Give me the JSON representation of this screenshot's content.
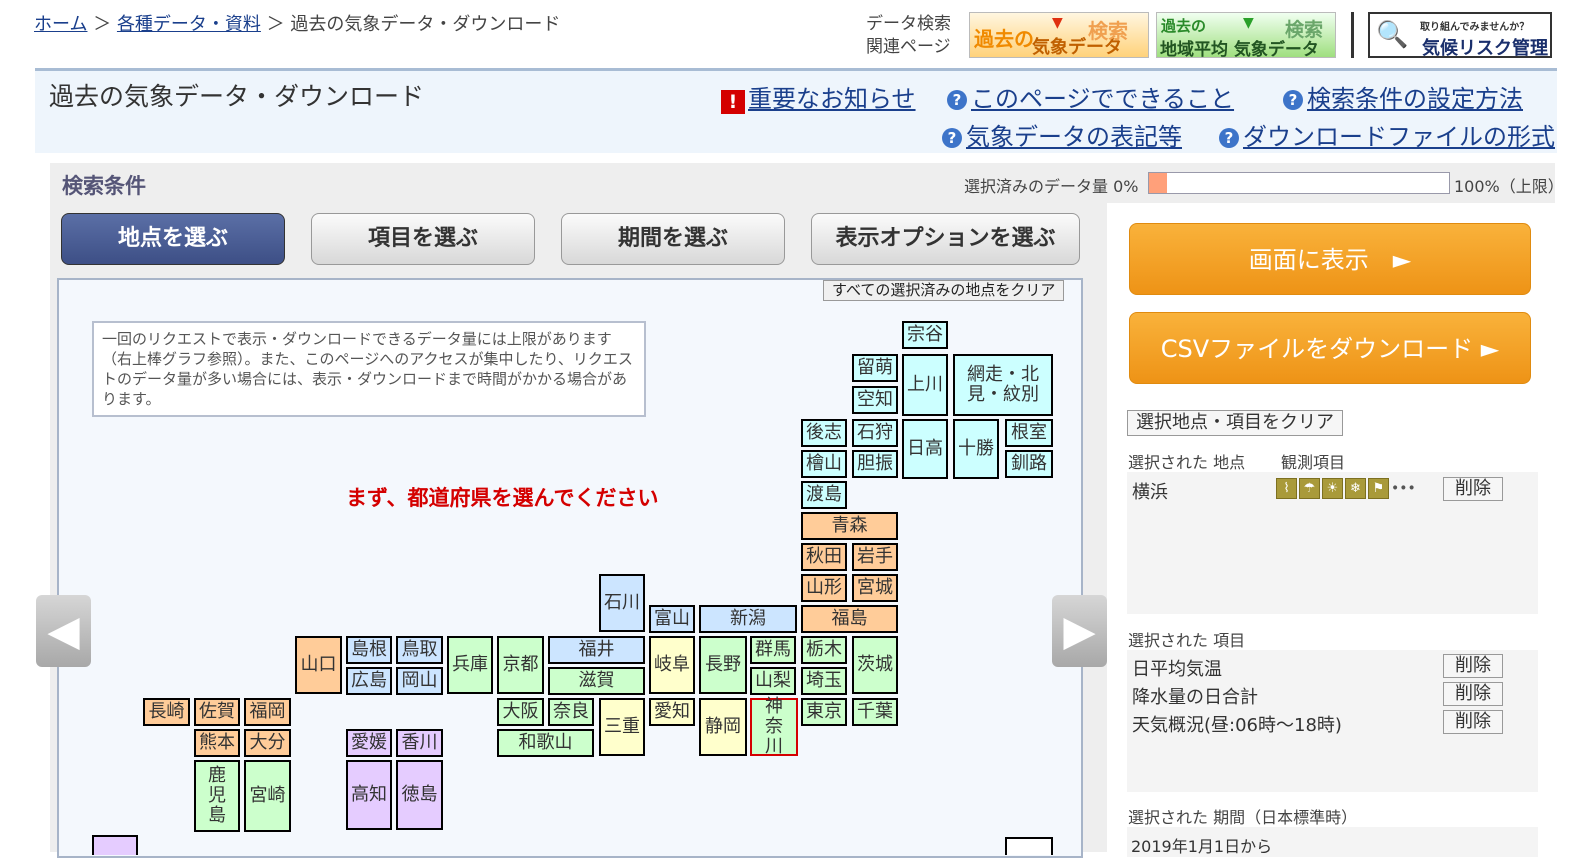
{
  "breadcrumb": {
    "home": "ホーム",
    "sep1": "＞",
    "data": "各種データ・資料",
    "sep2": "＞",
    "current": "過去の気象データ・ダウンロード"
  },
  "related": {
    "line1": "データ検索",
    "line2": "関連ページ"
  },
  "banners": {
    "past": {
      "text1": "過去の",
      "text2": "気象データ",
      "badge": "検索"
    },
    "area": {
      "text1": "過去の",
      "text2": "地域平均 気象データ",
      "badge": "検索"
    },
    "climate": {
      "text1": "取り組んでみませんか？",
      "text2": "気候リスク管理"
    }
  },
  "header": {
    "title": "過去の気象データ・ダウンロード",
    "links": {
      "notice": "重要なお知らせ",
      "can_do": "このページでできること",
      "howto": "検索条件の設定方法",
      "notation": "気象データの表記等",
      "format": "ダウンロードファイルの形式"
    }
  },
  "search": {
    "label": "検索条件",
    "amount_label": "選択済みのデータ量 0%",
    "amount_percent": 0,
    "amount_max": "100%（上限）"
  },
  "tabs": {
    "station": "地点を選ぶ",
    "item": "項目を選ぶ",
    "period": "期間を選ぶ",
    "options": "表示オプションを選ぶ"
  },
  "map": {
    "clear_all": "すべての選択済みの地点をクリア",
    "notice": "一回のリクエストで表示・ダウンロードできるデータ量には上限があります（右上棒グラフ参照）。また、このページへのアクセスが集中したり、リクエストのデータ量が多い場合には、表示・ダウンロードまで時間がかかる場合があります。",
    "prompt": "まず、都道府県を選んでください",
    "prefs": {
      "soya": "宗谷",
      "rumoi": "留萌",
      "kamikawa": "上川",
      "abashiri": "網走・北見・紋別",
      "sorachi": "空知",
      "shiribeshi": "後志",
      "ishikari": "石狩",
      "hidaka": "日高",
      "tokachi": "十勝",
      "nemuro": "根室",
      "hiyama": "檜山",
      "iburi": "胆振",
      "kushiro": "釧路",
      "oshima": "渡島",
      "aomori": "青森",
      "akita": "秋田",
      "iwate": "岩手",
      "yamagata": "山形",
      "miyagi": "宮城",
      "ishikawa": "石川",
      "toyama": "富山",
      "niigata": "新潟",
      "fukushima": "福島",
      "yamaguchi": "山口",
      "shimane": "島根",
      "tottori": "鳥取",
      "hyogo": "兵庫",
      "kyoto": "京都",
      "fukui": "福井",
      "gifu": "岐阜",
      "nagano": "長野",
      "gunma": "群馬",
      "tochigi": "栃木",
      "ibaraki": "茨城",
      "hiroshima": "広島",
      "okayama": "岡山",
      "shiga": "滋賀",
      "yamanashi": "山梨",
      "saitama": "埼玉",
      "nagasaki": "長崎",
      "saga": "佐賀",
      "fukuoka": "福岡",
      "osaka": "大阪",
      "nara": "奈良",
      "mie": "三重",
      "aichi": "愛知",
      "shizuoka": "静岡",
      "kanagawa": "神奈川",
      "tokyo": "東京",
      "chiba": "千葉",
      "kumamoto": "熊本",
      "oita": "大分",
      "ehime": "愛媛",
      "kagawa": "香川",
      "wakayama": "和歌山",
      "kagoshima": "鹿児島",
      "miyazaki": "宮崎",
      "kochi": "高知",
      "tokushima": "徳島"
    }
  },
  "nav": {
    "prev": "◀",
    "next": "▶"
  },
  "actions": {
    "display": "画面に表示　►",
    "csv": "CSVファイルをダウンロード ►",
    "clear_selection": "選択地点・項目をクリア"
  },
  "selected_stations": {
    "label": "選択された 地点",
    "items_label": "観測項目",
    "rows": [
      {
        "name": "横浜",
        "delete": "削除"
      }
    ]
  },
  "selected_items": {
    "label": "選択された 項目",
    "rows": [
      {
        "name": "日平均気温",
        "delete": "削除"
      },
      {
        "name": "降水量の日合計",
        "delete": "削除"
      },
      {
        "name": "天気概況(昼:06時～18時)",
        "delete": "削除"
      }
    ]
  },
  "selected_period": {
    "label": "選択された 期間（日本標準時）",
    "from": "2019年1月1日から"
  },
  "colors": {
    "hokkaido": "#ccffff",
    "tohoku": "#ffcc99",
    "kanto": "#ccffcc",
    "chubu": "#ffffcc",
    "kinki": "#ccffcc",
    "chugoku": "#ffcc99",
    "shikoku": "#e5ccff",
    "kyushu": "#ffcc99",
    "hokuriku": "#cce5ff",
    "accent": "#ee9316"
  }
}
